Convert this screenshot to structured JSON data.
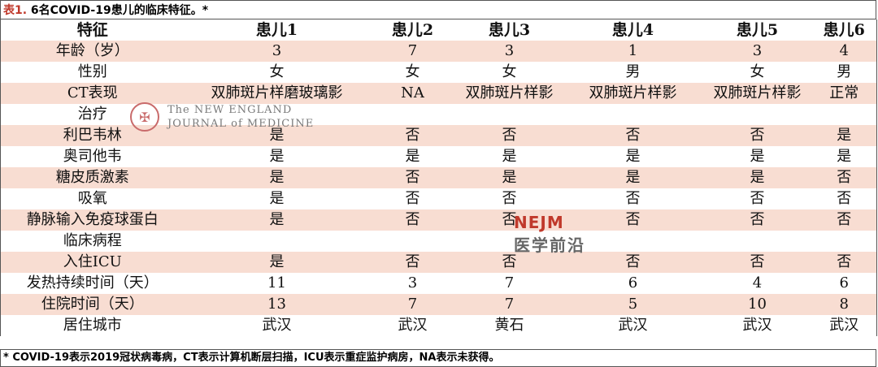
{
  "title": {
    "label": "表1.",
    "text": " 6名COVID-19患儿的临床特征。*"
  },
  "headers": [
    "特征",
    "患儿1",
    "患儿2",
    "患儿3",
    "患儿4",
    "患儿5",
    "患儿6"
  ],
  "rows": [
    [
      "年龄（岁）",
      "3",
      "7",
      "3",
      "1",
      "3",
      "4"
    ],
    [
      "性别",
      "女",
      "女",
      "女",
      "男",
      "女",
      "男"
    ],
    [
      "CT表现",
      "双肺斑片样磨玻璃影",
      "NA",
      "双肺斑片样影",
      "双肺斑片样影",
      "双肺斑片样影",
      "正常"
    ],
    [
      "治疗",
      "",
      "",
      "",
      "",
      "",
      ""
    ],
    [
      "利巴韦林",
      "是",
      "否",
      "否",
      "否",
      "否",
      "是"
    ],
    [
      "奥司他韦",
      "是",
      "是",
      "是",
      "是",
      "是",
      "是"
    ],
    [
      "糖皮质激素",
      "是",
      "否",
      "是",
      "是",
      "是",
      "否"
    ],
    [
      "吸氧",
      "是",
      "否",
      "否",
      "否",
      "否",
      "否"
    ],
    [
      "静脉输入免疫球蛋白",
      "是",
      "否",
      "否",
      "否",
      "否",
      "否"
    ],
    [
      "临床病程",
      "",
      "",
      "",
      "",
      "",
      ""
    ],
    [
      "入住ICU",
      "是",
      "否",
      "否",
      "否",
      "否",
      "否"
    ],
    [
      "发热持续时间（天）",
      "11",
      "3",
      "7",
      "6",
      "4",
      "6"
    ],
    [
      "住院时间（天）",
      "13",
      "7",
      "7",
      "5",
      "10",
      "8"
    ],
    [
      "居住城市",
      "武汉",
      "武汉",
      "黄石",
      "武汉",
      "武汉",
      "武汉"
    ]
  ],
  "footnote": "* COVID-19表示2019冠状病毒病，CT表示计算机断层扫描，ICU表示重症监护病房，NA表示未获得。",
  "watermarks": {
    "seal_icon": "nejm-seal-icon",
    "journal_line1": "The NEW ENGLAND",
    "journal_line2": "JOURNAL of MEDICINE",
    "nejm": "NEJM",
    "nejm_cn": "医学前沿"
  },
  "colors": {
    "row_pink": "#f8ddd2",
    "row_white": "#ffffff",
    "label_red": "#c0392b"
  }
}
